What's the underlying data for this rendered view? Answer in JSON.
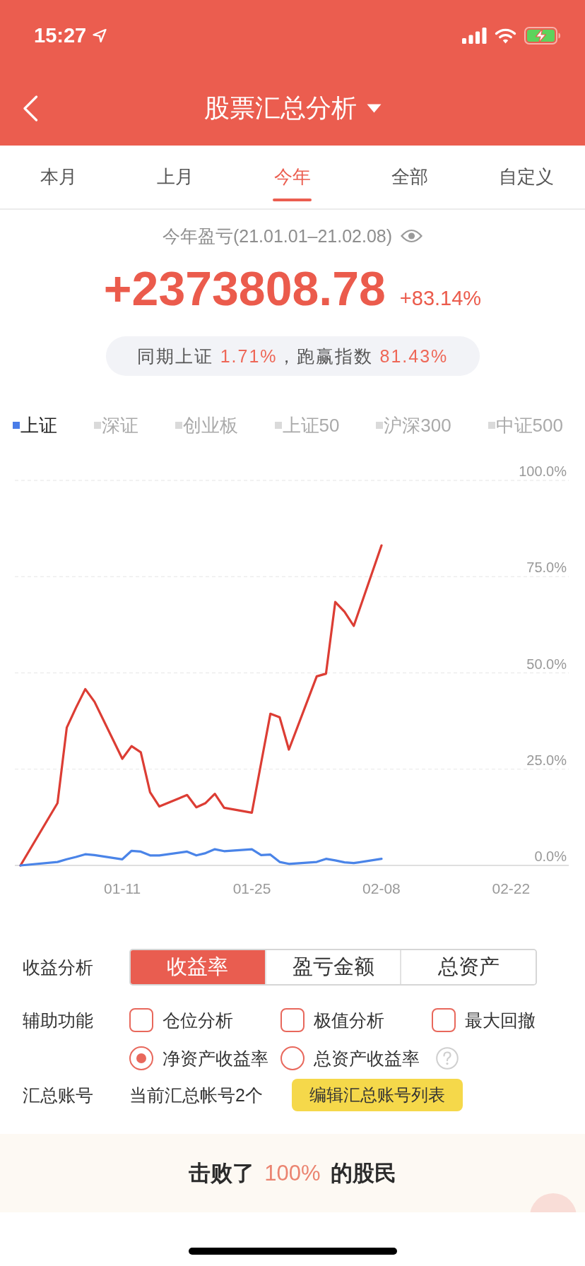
{
  "status_bar": {
    "time": "15:27"
  },
  "header": {
    "title": "股票汇总分析"
  },
  "tabs": [
    {
      "label": "本月",
      "selected": false
    },
    {
      "label": "上月",
      "selected": false
    },
    {
      "label": "今年",
      "selected": true
    },
    {
      "label": "全部",
      "selected": false
    },
    {
      "label": "自定义",
      "selected": false
    }
  ],
  "summary": {
    "caption": "今年盈亏(21.01.01–21.02.08)",
    "profit": "+2373808.78",
    "return_rate": "+83.14%",
    "comparison": [
      {
        "kind": "label",
        "text": "同期上证"
      },
      {
        "kind": "value",
        "text": "1.71%"
      },
      {
        "kind": "label",
        "text": "，跑赢指数"
      },
      {
        "kind": "value",
        "text": "81.43%"
      }
    ]
  },
  "chart": {
    "legend": [
      {
        "label": "上证",
        "selected": true
      },
      {
        "label": "深证",
        "selected": false
      },
      {
        "label": "创业板",
        "selected": false
      },
      {
        "label": "上证50",
        "selected": false
      },
      {
        "label": "沪深300",
        "selected": false
      },
      {
        "label": "中证500",
        "selected": false
      }
    ],
    "chart_data": {
      "type": "line",
      "grid": true,
      "categories": [
        null,
        null,
        null,
        null,
        null,
        null,
        null,
        null,
        null,
        null,
        null,
        "01-11",
        null,
        null,
        null,
        null,
        null,
        null,
        null,
        null,
        null,
        null,
        null,
        null,
        null,
        "01-25",
        null,
        null,
        null,
        null,
        null,
        null,
        null,
        null,
        null,
        null,
        null,
        null,
        null,
        "02-08",
        null,
        null,
        null,
        null,
        null,
        null,
        null,
        null,
        null,
        null,
        null,
        null,
        null,
        "02-22",
        null,
        null,
        null,
        null,
        null,
        null
      ],
      "ylim": [
        0,
        100
      ],
      "yticks": [
        {
          "value": 0,
          "label": "0.0%"
        },
        {
          "value": 25,
          "label": "25.0%"
        },
        {
          "value": 50,
          "label": "50.0%"
        },
        {
          "value": 75,
          "label": "75.0%"
        },
        {
          "value": 100,
          "label": "100.0%"
        }
      ],
      "series": [
        {
          "color": "#dc3d34",
          "values": [
            0,
            null,
            null,
            null,
            16.2,
            35.8,
            41,
            45.8,
            42.5,
            null,
            null,
            27.7,
            31.0,
            29.4,
            19.0,
            15.3,
            null,
            null,
            18.3,
            15.1,
            16.2,
            18.6,
            15.0,
            null,
            null,
            13.7,
            26.6,
            39.4,
            38.5,
            30.1,
            null,
            null,
            49.1,
            49.8,
            68.4,
            65.9,
            62.2,
            null,
            null,
            83.1,
            null,
            null,
            null,
            null,
            null,
            null,
            null,
            null,
            null,
            null,
            null,
            null,
            null,
            null,
            null,
            null,
            null,
            null,
            null,
            null
          ]
        },
        {
          "color": "#4a84e8",
          "values": [
            0,
            null,
            null,
            null,
            0.9,
            1.6,
            2.2,
            2.9,
            2.7,
            null,
            null,
            1.6,
            3.8,
            3.6,
            2.6,
            2.6,
            null,
            null,
            3.6,
            2.6,
            3.2,
            4.2,
            3.7,
            null,
            null,
            4.2,
            2.7,
            2.8,
            0.9,
            0.4,
            null,
            null,
            0.9,
            1.7,
            1.3,
            0.8,
            0.6,
            null,
            null,
            1.7,
            null,
            null,
            null,
            null,
            null,
            null,
            null,
            null,
            null,
            null,
            null,
            null,
            null,
            null,
            null,
            null,
            null,
            null,
            null,
            null
          ]
        }
      ]
    }
  },
  "controls": {
    "return_analysis": {
      "label": "收益分析",
      "options": [
        {
          "label": "收益率",
          "selected": true
        },
        {
          "label": "盈亏金额",
          "selected": false
        },
        {
          "label": "总资产",
          "selected": false
        }
      ]
    },
    "auxiliary": {
      "label": "辅助功能",
      "checkboxes": [
        {
          "label": "仓位分析",
          "checked": false
        },
        {
          "label": "极值分析",
          "checked": false
        },
        {
          "label": "最大回撤",
          "checked": false
        }
      ],
      "radios": [
        {
          "label": "净资产收益率",
          "selected": true
        },
        {
          "label": "总资产收益率",
          "selected": false
        }
      ]
    },
    "accounts": {
      "label": "汇总账号",
      "text": "当前汇总帐号2个",
      "button": "编辑汇总账号列表"
    }
  },
  "banner": {
    "segments": [
      {
        "kind": "label",
        "text": "击败了"
      },
      {
        "kind": "value",
        "text": "100%"
      },
      {
        "kind": "label",
        "text": "的股民"
      }
    ]
  }
}
